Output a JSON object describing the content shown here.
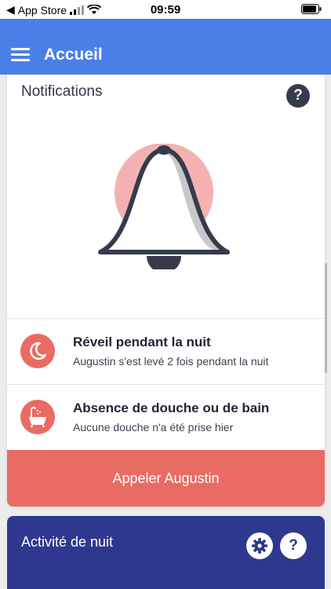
{
  "status_bar": {
    "back_app": "App Store",
    "time": "09:59"
  },
  "header": {
    "title": "Accueil"
  },
  "notifications": {
    "title": "Notifications",
    "help_label": "?",
    "items": [
      {
        "title": "Réveil pendant la nuit",
        "subtitle": "Augustin s'est levé 2 fois pendant la nuit",
        "icon": "moon-icon"
      },
      {
        "title": "Absence de douche ou de bain",
        "subtitle": "Aucune douche n'a été prise hier",
        "icon": "bathtub-icon"
      }
    ],
    "call_button": "Appeler Augustin"
  },
  "night_activity": {
    "title": "Activité de nuit",
    "help_label": "?"
  },
  "colors": {
    "header": "#4a7fe8",
    "accent_red": "#ea6b64",
    "night_card": "#2e388f",
    "dark": "#353b4b",
    "bell_circle": "#f3b2b1"
  }
}
